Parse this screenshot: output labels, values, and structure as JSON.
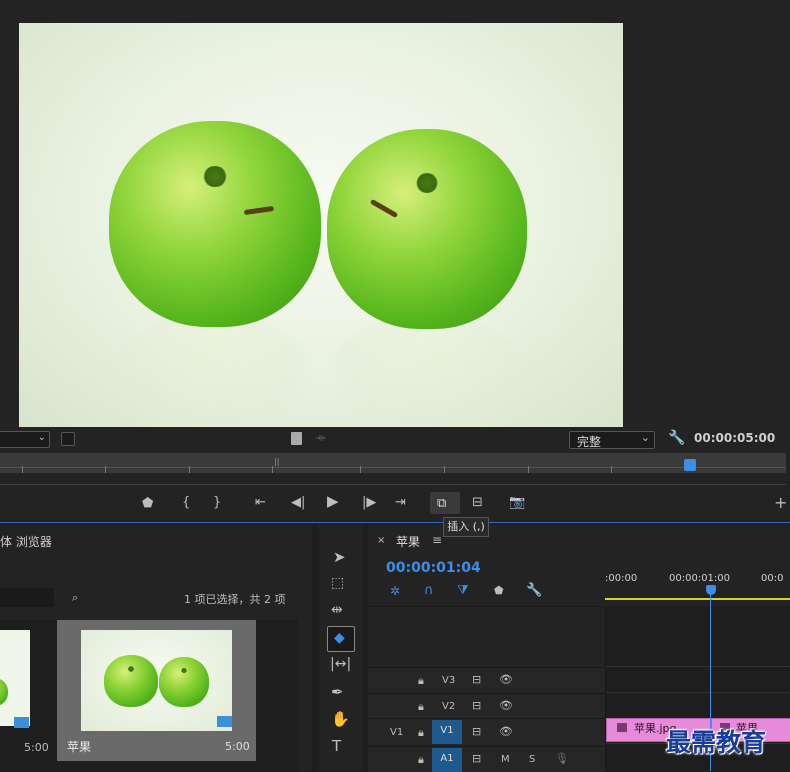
{
  "monitor": {
    "quality": "完整",
    "duration": "00:00:05:00",
    "tooltip": "插入 (,)"
  },
  "project": {
    "panel_title": "体 浏览器",
    "selection_info": "1 项已选择，共 2 项",
    "items": [
      {
        "name": "",
        "duration": "5:00"
      },
      {
        "name": "苹果",
        "duration": "5:00"
      }
    ]
  },
  "timeline": {
    "sequence_name": "苹果",
    "timecode": "00:00:01:04",
    "ruler": [
      ":00:00",
      "00:00:01:00",
      "00:0"
    ],
    "tracks": [
      {
        "id": "V3"
      },
      {
        "id": "V2"
      },
      {
        "id": "V1",
        "source": "V1"
      },
      {
        "id": "A1",
        "mute": "M",
        "solo": "S"
      }
    ],
    "clips": [
      "苹果.jpg",
      "苹果"
    ]
  },
  "watermark": "最需教育",
  "colors": {
    "accent": "#2d8ceb",
    "playhead": "#3e8ee6",
    "clip": "#e68ad9",
    "timeline_bar": "#d8d226"
  }
}
